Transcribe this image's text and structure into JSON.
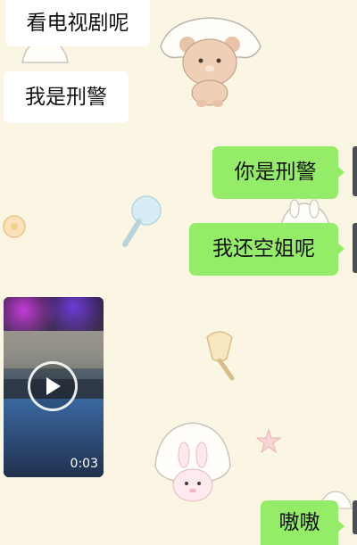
{
  "messages": {
    "m1": {
      "text": "看电视剧呢",
      "direction": "incoming"
    },
    "m2": {
      "text": "我是刑警",
      "direction": "incoming"
    },
    "m3": {
      "text": "你是刑警",
      "direction": "outgoing"
    },
    "m4": {
      "text": "我还空姐呢",
      "direction": "outgoing"
    },
    "video": {
      "duration": "0:03",
      "direction": "incoming"
    },
    "m5": {
      "text": "嗷嗷",
      "direction": "outgoing"
    }
  },
  "colors": {
    "background": "#fbf6e3",
    "incoming_bubble": "#ffffff",
    "outgoing_bubble": "#95ec69"
  },
  "icons": {
    "play": "play-icon",
    "wallpaper": [
      "bear-icon",
      "bunny-icon",
      "lollipop-icon",
      "popsicle-icon",
      "star-icon",
      "flower-icon"
    ]
  }
}
